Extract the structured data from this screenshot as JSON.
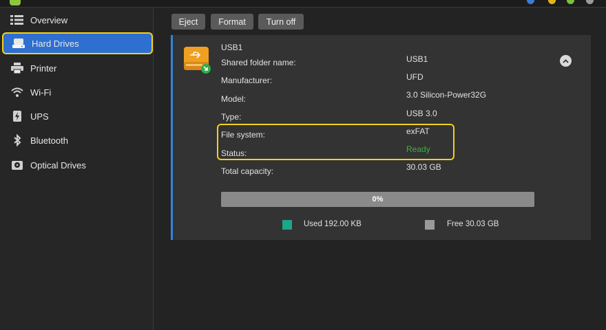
{
  "colors": {
    "accent_selected": "#2f6fd0",
    "highlight": "#f2d21b",
    "ready": "#3cb043",
    "used": "#1ca68b",
    "free": "#9a9a9a",
    "panel_border": "#2f86e0"
  },
  "sidebar": {
    "items": [
      {
        "label": "Overview",
        "icon": "overview-icon"
      },
      {
        "label": "Hard Drives",
        "icon": "hard-drive-icon",
        "selected": true
      },
      {
        "label": "Printer",
        "icon": "printer-icon"
      },
      {
        "label": "Wi-Fi",
        "icon": "wifi-icon"
      },
      {
        "label": "UPS",
        "icon": "ups-icon"
      },
      {
        "label": "Bluetooth",
        "icon": "bluetooth-icon"
      },
      {
        "label": "Optical Drives",
        "icon": "optical-drive-icon"
      }
    ]
  },
  "toolbar": {
    "eject": "Eject",
    "format": "Format",
    "turn_off": "Turn off"
  },
  "drive": {
    "name": "USB1",
    "fields": [
      {
        "label": "Shared folder name:",
        "value": "USB1"
      },
      {
        "label": "Manufacturer:",
        "value": "UFD"
      },
      {
        "label": "Model:",
        "value": "3.0 Silicon-Power32G"
      },
      {
        "label": "Type:",
        "value": "USB 3.0"
      },
      {
        "label": "File system:",
        "value": "exFAT"
      },
      {
        "label": "Status:",
        "value": "Ready"
      },
      {
        "label": "Total capacity:",
        "value": "30.03 GB"
      }
    ],
    "usage_percent_label": "0%",
    "usage_fraction": 0.0,
    "used_label": "Used 192.00 KB",
    "free_label": "Free 30.03 GB"
  }
}
